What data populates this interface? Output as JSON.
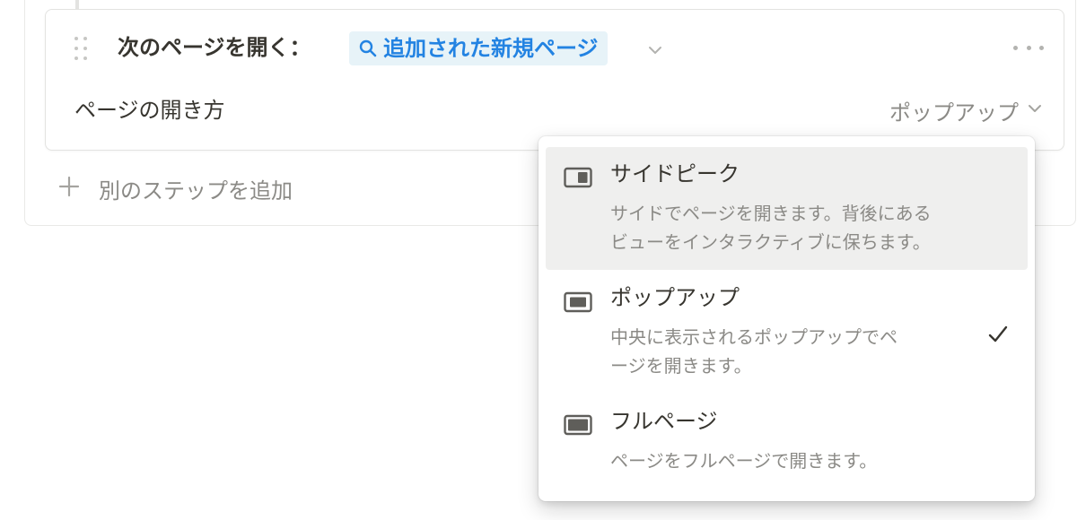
{
  "step": {
    "label": "次のページを開く：",
    "target_page": "追加された新規ページ",
    "open_method_label": "ページの開き方",
    "open_method_value": "ポップアップ"
  },
  "add_step_label": "別のステップを追加",
  "menu": {
    "items": [
      {
        "icon": "side-peek-icon",
        "title": "サイドピーク",
        "desc_line1": "サイドでページを開きます。背後にある",
        "desc_line2": "ビューをインタラクティブに保ちます。",
        "selected": false
      },
      {
        "icon": "center-peek-icon",
        "title": "ポップアップ",
        "desc_line1": "中央に表示されるポップアップでペ",
        "desc_line2": "ージを開きます。",
        "selected": true
      },
      {
        "icon": "full-page-icon",
        "title": "フルページ",
        "desc_line1": "ページをフルページで開きます。",
        "desc_line2": "",
        "selected": false
      }
    ]
  },
  "colors": {
    "link_blue": "#2383e2",
    "chip_bg": "#e7f3f8",
    "hover_bg": "#efefee",
    "muted_text": "#8b8a86"
  }
}
